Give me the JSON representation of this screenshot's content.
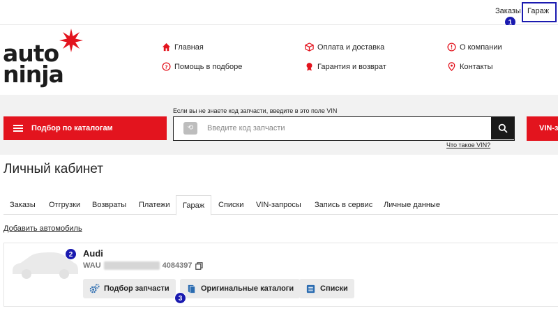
{
  "topbar": {
    "orders_label": "Заказы",
    "garage_label": "Гараж",
    "marker_1": "1"
  },
  "logo": {
    "line1": "auto",
    "line2": "ninja",
    "brand_color": "#e3141e"
  },
  "nav": {
    "home": "Главная",
    "payment": "Оплата и доставка",
    "about": "О компании",
    "help": "Помощь в подборе",
    "warranty": "Гарантия и возврат",
    "contacts": "Контакты"
  },
  "search": {
    "catalog_button": "Подбор по каталогам",
    "hint": "Если вы не знаете код запчасти, введите в это поле VIN",
    "placeholder": "Введите код запчасти",
    "value": "",
    "vin_link": "Что такое VIN?",
    "vin_button": "VIN-запрос"
  },
  "account": {
    "title": "Личный кабинет",
    "tabs": [
      "Заказы",
      "Отгрузки",
      "Возвраты",
      "Платежи",
      "Гараж",
      "Списки",
      "VIN-запросы",
      "Запись в сервис",
      "Личные данные"
    ],
    "active_tab": "Гараж",
    "add_car": "Добавить автомобиль"
  },
  "car": {
    "brand": "Audi",
    "vin_prefix": "WAU",
    "vin_suffix": "4084397",
    "marker_2": "2",
    "marker_3": "3",
    "buttons": {
      "parts": "Подбор запчасти",
      "catalogs": "Оригинальные каталоги",
      "lists": "Списки"
    }
  },
  "colors": {
    "accent_red": "#e3141e",
    "annotation_blue": "#1a1ab0",
    "icon_blue": "#2b6cb0"
  }
}
